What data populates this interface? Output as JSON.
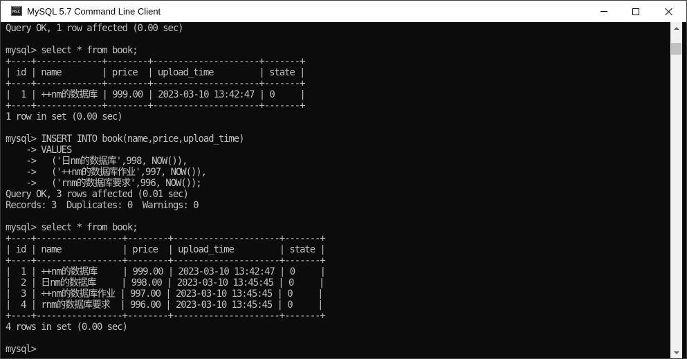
{
  "window": {
    "title": "MySQL 5.7 Command Line Client",
    "icon_text": "MSC",
    "icon": "console-app-icon"
  },
  "controls": {
    "minimize_icon": "minimize-icon",
    "maximize_icon": "maximize-icon",
    "close_icon": "close-icon"
  },
  "console": {
    "lines": [
      "Query OK, 1 row affected (0.00 sec)",
      "",
      "mysql> select * from book;",
      "+----+-------------+--------+---------------------+-------+",
      "| id | name        | price  | upload_time         | state |",
      "+----+-------------+--------+---------------------+-------+",
      "|  1 | ++nm的数据库 | 999.00 | 2023-03-10 13:42:47 | 0     |",
      "+----+-------------+--------+---------------------+-------+",
      "1 row in set (0.00 sec)",
      "",
      "mysql> INSERT INTO book(name,price,upload_time)",
      "    -> VALUES",
      "    ->   ('日nm的数据库',998, NOW()),",
      "    ->   ('++nm的数据库作业',997, NOW()),",
      "    ->   ('rnm的数据库要求',996, NOW());",
      "Query OK, 3 rows affected (0.01 sec)",
      "Records: 3  Duplicates: 0  Warnings: 0",
      "",
      "mysql> select * from book;",
      "+----+-----------------+--------+---------------------+-------+",
      "| id | name            | price  | upload_time         | state |",
      "+----+-----------------+--------+---------------------+-------+",
      "|  1 | ++nm的数据库     | 999.00 | 2023-03-10 13:42:47 | 0     |",
      "|  2 | 日nm的数据库     | 998.00 | 2023-03-10 13:45:45 | 0     |",
      "|  3 | ++nm的数据库作业 | 997.00 | 2023-03-10 13:45:45 | 0     |",
      "|  4 | rnm的数据库要求  | 996.00 | 2023-03-10 13:45:45 | 0     |",
      "+----+-----------------+--------+---------------------+-------+",
      "4 rows in set (0.00 sec)",
      "",
      "mysql>"
    ]
  },
  "scrollbar": {
    "up_icon": "scroll-up-arrow-icon",
    "down_icon": "scroll-down-arrow-icon",
    "position": 0.03
  },
  "colors": {
    "console_bg": "#0c0c0c",
    "console_text": "#c0c0c0",
    "titlebar_bg": "#ffffff"
  }
}
